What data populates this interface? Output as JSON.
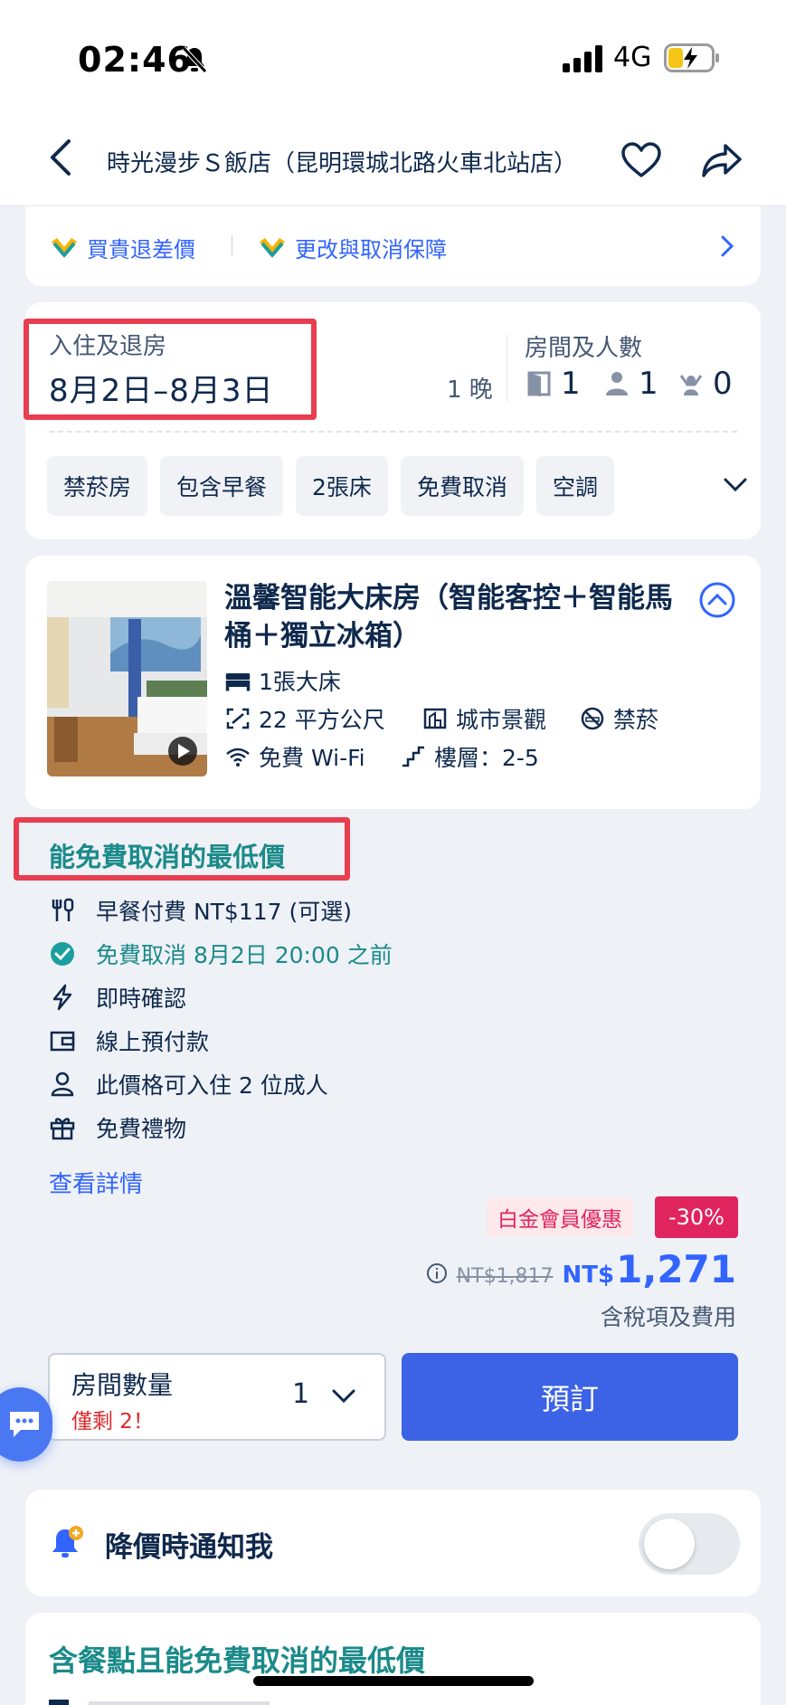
{
  "status_bar": {
    "time": "02:46",
    "network": "4G"
  },
  "nav": {
    "title": "時光漫步Ｓ飯店（昆明環城北路火車北站店）"
  },
  "guarantees": {
    "items": [
      "買貴退差價",
      "更改與取消保障"
    ]
  },
  "stay": {
    "checkin_label": "入住及退房",
    "dates": "8月2日–8月3日",
    "nights": "1 晚",
    "rooms_guests_label": "房間及人數",
    "rooms": "1",
    "adults": "1",
    "children": "0"
  },
  "filters": {
    "chips": [
      "禁菸房",
      "包含早餐",
      "2張床",
      "免費取消",
      "空調"
    ]
  },
  "room": {
    "name": "溫馨智能大床房（智能客控＋智能馬桶＋獨立冰箱）",
    "bed": "1張大床",
    "size": "22 平方公尺",
    "view": "城市景觀",
    "smoking": "禁菸",
    "wifi": "免費 Wi-Fi",
    "floor": "樓層：2-5"
  },
  "rate": {
    "heading": "能免費取消的最低價",
    "perks": {
      "breakfast": "早餐付費 NT$117 (可選)",
      "cancel": "免費取消 8月2日 20:00 之前",
      "confirm": "即時確認",
      "prepay": "線上預付款",
      "occupancy": "此價格可入住 2 位成人",
      "gift": "免費禮物"
    },
    "details_link": "查看詳情",
    "member_badge": "白金會員優惠",
    "discount": "-30%",
    "old_price": "NT$1,817",
    "currency": "NT$",
    "price": "1,271",
    "tax_note": "含稅項及費用",
    "qty_label": "房間數量",
    "qty_remaining": "僅剩 2！",
    "qty_value": "1",
    "book_label": "預訂"
  },
  "notify": {
    "label": "降價時通知我",
    "enabled": false
  },
  "next_rate": {
    "heading": "含餐點且能免費取消的最低價"
  },
  "colors": {
    "accent": "#3264ff",
    "teal": "#1b8a8a",
    "highlight": "#e93d50",
    "book": "#3c63e6"
  }
}
